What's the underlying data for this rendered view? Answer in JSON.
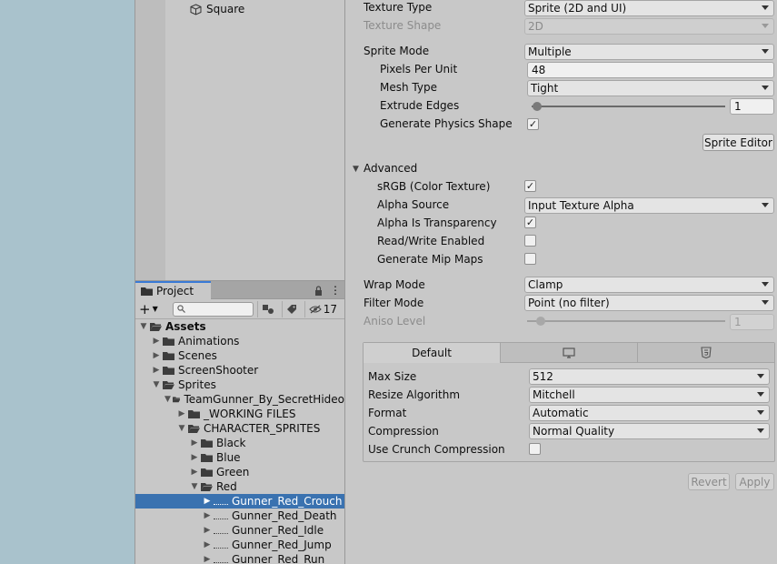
{
  "hierarchy": {
    "square_label": "Square"
  },
  "project": {
    "tab_label": "Project",
    "hidden_count": "17",
    "search_placeholder": "",
    "tree": [
      {
        "label": "Assets",
        "depth": 0,
        "state": "open",
        "kind": "folder",
        "bold": true
      },
      {
        "label": "Animations",
        "depth": 1,
        "state": "closed",
        "kind": "folder"
      },
      {
        "label": "Scenes",
        "depth": 1,
        "state": "closed",
        "kind": "folder"
      },
      {
        "label": "ScreenShooter",
        "depth": 1,
        "state": "closed",
        "kind": "folder"
      },
      {
        "label": "Sprites",
        "depth": 1,
        "state": "open",
        "kind": "folder"
      },
      {
        "label": "TeamGunner_By_SecretHideo",
        "depth": 2,
        "state": "open",
        "kind": "folder"
      },
      {
        "label": "_WORKING FILES",
        "depth": 3,
        "state": "closed",
        "kind": "folder"
      },
      {
        "label": "CHARACTER_SPRITES",
        "depth": 3,
        "state": "open",
        "kind": "folder"
      },
      {
        "label": "Black",
        "depth": 4,
        "state": "closed",
        "kind": "folder"
      },
      {
        "label": "Blue",
        "depth": 4,
        "state": "closed",
        "kind": "folder"
      },
      {
        "label": "Green",
        "depth": 4,
        "state": "closed",
        "kind": "folder"
      },
      {
        "label": "Red",
        "depth": 4,
        "state": "open",
        "kind": "folder"
      },
      {
        "label": "Gunner_Red_Crouch",
        "depth": 5,
        "state": "closed",
        "kind": "sprite",
        "selected": true
      },
      {
        "label": "Gunner_Red_Death",
        "depth": 5,
        "state": "closed",
        "kind": "sprite"
      },
      {
        "label": "Gunner_Red_Idle",
        "depth": 5,
        "state": "closed",
        "kind": "sprite"
      },
      {
        "label": "Gunner_Red_Jump",
        "depth": 5,
        "state": "closed",
        "kind": "sprite"
      },
      {
        "label": "Gunner_Red_Run",
        "depth": 5,
        "state": "closed",
        "kind": "sprite"
      }
    ]
  },
  "inspector": {
    "texture_type_label": "Texture Type",
    "texture_type_value": "Sprite (2D and UI)",
    "texture_shape_label": "Texture Shape",
    "texture_shape_value": "2D",
    "sprite_mode_label": "Sprite Mode",
    "sprite_mode_value": "Multiple",
    "pixels_per_unit_label": "Pixels Per Unit",
    "pixels_per_unit_value": "48",
    "mesh_type_label": "Mesh Type",
    "mesh_type_value": "Tight",
    "extrude_edges_label": "Extrude Edges",
    "extrude_edges_value": "1",
    "extrude_edges_fraction": 0.03,
    "generate_physics_label": "Generate Physics Shape",
    "generate_physics_checked": true,
    "sprite_editor_label": "Sprite Editor",
    "advanced_label": "Advanced",
    "srgb_label": "sRGB (Color Texture)",
    "srgb_checked": true,
    "alpha_source_label": "Alpha Source",
    "alpha_source_value": "Input Texture Alpha",
    "alpha_transparency_label": "Alpha Is Transparency",
    "alpha_transparency_checked": true,
    "read_write_label": "Read/Write Enabled",
    "read_write_checked": false,
    "mipmaps_label": "Generate Mip Maps",
    "mipmaps_checked": false,
    "wrap_mode_label": "Wrap Mode",
    "wrap_mode_value": "Clamp",
    "filter_mode_label": "Filter Mode",
    "filter_mode_value": "Point (no filter)",
    "aniso_label": "Aniso Level",
    "aniso_value": "1",
    "aniso_fraction": 0.07,
    "platform_tab_default": "Default",
    "max_size_label": "Max Size",
    "max_size_value": "512",
    "resize_label": "Resize Algorithm",
    "resize_value": "Mitchell",
    "format_label": "Format",
    "format_value": "Automatic",
    "compression_label": "Compression",
    "compression_value": "Normal Quality",
    "crunch_label": "Use Crunch Compression",
    "crunch_checked": false,
    "revert_label": "Revert",
    "apply_label": "Apply"
  },
  "colors": {
    "scene_bg": "#a9c2cc",
    "panel_bg": "#c8c8c8",
    "selection": "#3a72b0",
    "tab_accent": "#3a7ad6"
  }
}
